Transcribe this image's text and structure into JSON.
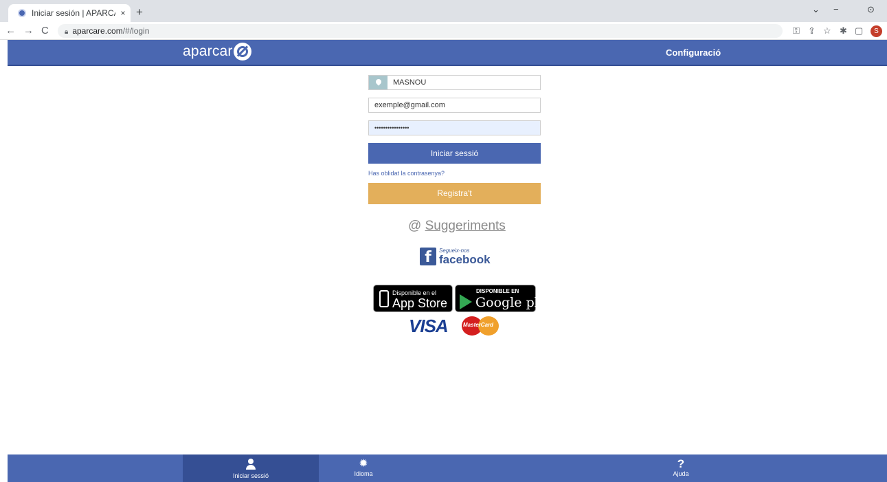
{
  "browser": {
    "tab_title": "Iniciar sesión | APARCARE",
    "tab_close": "×",
    "new_tab": "+",
    "url_host": "aparcare.com",
    "url_path": "/#/login",
    "profile_initial": "S"
  },
  "header": {
    "logo_text": "aparcar",
    "config_label": "Configuració"
  },
  "login": {
    "city_value": "MASNOU",
    "email_placeholder": "exemple@gmail.com",
    "password_value": "••••••••••••••••",
    "login_button": "Iniciar sessió",
    "forgot_link": "Has oblidat la contrasenya?",
    "register_button": "Registra't"
  },
  "suggestions": {
    "at": "@",
    "label": "Suggeriments"
  },
  "facebook": {
    "follow_text": "Segueix-nos",
    "brand": "facebook"
  },
  "stores": {
    "apple_line1": "Disponible en el",
    "apple_line2": "App Store",
    "google_line1": "DISPONIBLE EN",
    "google_line2": "Google play"
  },
  "payments": {
    "visa": "VISA",
    "mastercard": "MasterCard"
  },
  "bottom_nav": {
    "login": "Iniciar sessió",
    "language": "Idioma",
    "help_icon": "?",
    "help": "Ajuda"
  },
  "colors": {
    "brand_blue": "#4a67b1",
    "brand_blue_dark": "#354f94",
    "register_gold": "#e3af5b"
  }
}
